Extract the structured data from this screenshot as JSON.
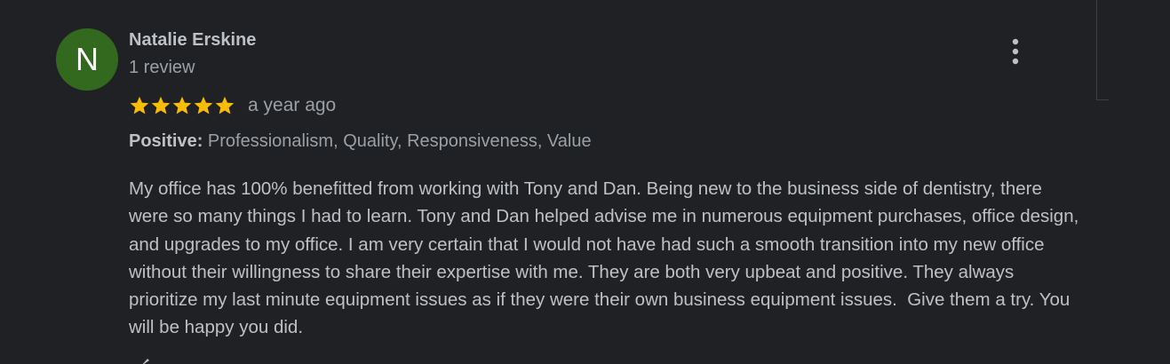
{
  "reviewer": {
    "initial": "N",
    "name": "Natalie Erskine",
    "review_count": "1 review",
    "avatar_color": "#33691e"
  },
  "rating": {
    "stars": 5,
    "max_stars": 5,
    "star_color": "#fbbc04",
    "time_ago": "a year ago"
  },
  "attributes": {
    "label": "Positive:",
    "values": "Professionalism, Quality, Responsiveness, Value"
  },
  "review": {
    "text": "My office has 100% benefitted from working with Tony and Dan. Being new to the business side of dentistry, there were so many things I had to learn. Tony and Dan helped advise me in numerous equipment purchases, office design, and upgrades to my office. I am very certain that I would not have had such a smooth transition into my new office without their willingness to share their expertise with me. They are both very upbeat and positive. They always prioritize my last minute equipment issues as if they were their own business equipment issues.  Give them a try. You will be happy you did."
  },
  "icons": {
    "menu": "more-vertical-icon",
    "star": "star-icon",
    "like": "thumbs-up-icon"
  }
}
